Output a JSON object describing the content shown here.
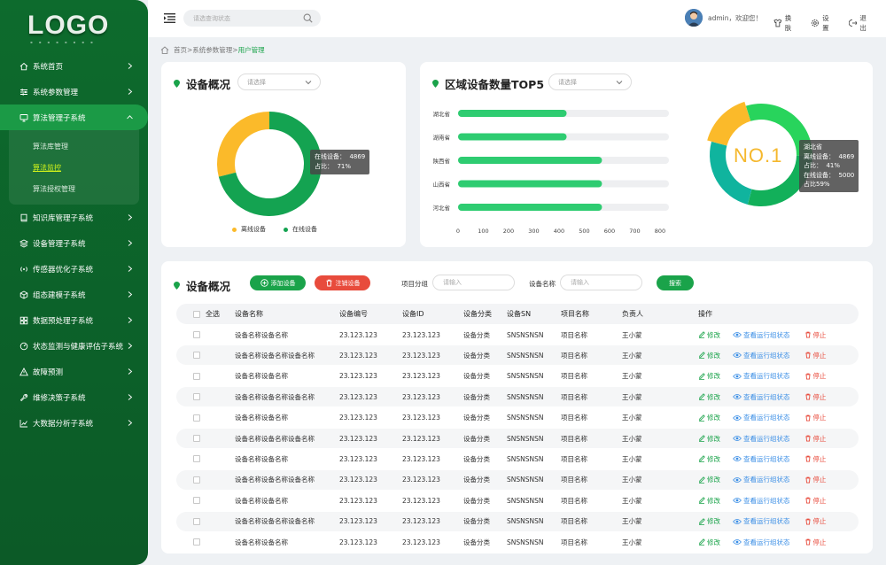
{
  "brand": {
    "logo": "LOGO"
  },
  "colors": {
    "primary": "#0d6b2d",
    "accent": "#1aa34a",
    "online": "#14a351",
    "offline": "#fbba2a",
    "danger": "#e84b3c",
    "link": "#3a8ee6"
  },
  "sidebar": {
    "items": [
      {
        "label": "系统首页",
        "icon": "home-icon"
      },
      {
        "label": "系统参数管理",
        "icon": "sliders-icon"
      },
      {
        "label": "算法管理子系统",
        "icon": "monitor-icon",
        "expanded": true,
        "children": [
          {
            "label": "算法库管理"
          },
          {
            "label": "算法监控",
            "active": true
          },
          {
            "label": "算法授权管理"
          }
        ]
      },
      {
        "label": "知识库管理子系统",
        "icon": "book-icon"
      },
      {
        "label": "设备管理子系统",
        "icon": "layers-icon"
      },
      {
        "label": "传感器优化子系统",
        "icon": "signal-icon"
      },
      {
        "label": "组态建模子系统",
        "icon": "cube-icon"
      },
      {
        "label": "数据预处理子系统",
        "icon": "grid-icon"
      },
      {
        "label": "状态监测与健康评估子系统",
        "icon": "gauge-icon"
      },
      {
        "label": "故障预测",
        "icon": "alert-icon"
      },
      {
        "label": "维修决策子系统",
        "icon": "wrench-icon"
      },
      {
        "label": "大数据分析子系统",
        "icon": "chart-icon"
      }
    ]
  },
  "header": {
    "search_placeholder": "请选查询状态",
    "user_text": "admin，欢迎您！",
    "tools": [
      {
        "label": "换肤",
        "icon": "skin-icon"
      },
      {
        "label": "设置",
        "icon": "gear-icon"
      },
      {
        "label": "退出",
        "icon": "logout-icon"
      }
    ]
  },
  "breadcrumb": {
    "home": "首页",
    "sep1": ">",
    "level1": "系统参数管理",
    "sep2": ">",
    "current": "用户管理"
  },
  "overview_card": {
    "title": "设备概况",
    "select_placeholder": "请选择",
    "tooltip_line1": "在线设备：  4869",
    "tooltip_line2": "占比：  71%",
    "legend": [
      "离线设备",
      "在线设备"
    ]
  },
  "top5_card": {
    "title": "区域设备数量TOP5",
    "select_placeholder": "请选择",
    "badge": "NO.1",
    "tooltip_title": "湖北省",
    "tooltip_line1": "离线设备：  4869",
    "tooltip_line2": "占比：  41%",
    "tooltip_line3": "在线设备：  5000",
    "tooltip_line4": "占比59%"
  },
  "chart_data": [
    {
      "type": "pie",
      "variant": "donut",
      "categories": [
        "离线设备",
        "在线设备"
      ],
      "values": [
        29,
        71
      ],
      "colors": [
        "#fbba2a",
        "#14a351"
      ],
      "legend": "bottom"
    },
    {
      "type": "bar",
      "orientation": "horizontal",
      "categories": [
        "湖北省",
        "湖南省",
        "陕西省",
        "山西省",
        "河北省"
      ],
      "values": [
        430,
        430,
        570,
        570,
        570
      ],
      "xlim": [
        0,
        800
      ],
      "xticks": [
        "0",
        "100",
        "200",
        "300",
        "400",
        "500",
        "600",
        "700",
        "800"
      ],
      "bar_color": "#2ecc71"
    },
    {
      "type": "pie",
      "variant": "donut",
      "categories": [
        "在线设备",
        "离线设备"
      ],
      "values": [
        59,
        41
      ],
      "segments": [
        {
          "color": "#28d45c",
          "value": 30
        },
        {
          "color": "#12b05a",
          "value": 29
        },
        {
          "color": "#10b49e",
          "value": 25
        },
        {
          "color": "#fbba2a",
          "value": 16
        }
      ]
    }
  ],
  "table_card": {
    "title": "设备概况",
    "add_button": "添加设备",
    "delete_button": "注销设备",
    "group_label": "项目分组",
    "group_placeholder": "请输入",
    "name_label": "设备名称",
    "name_placeholder": "请输入",
    "search_button": "搜索",
    "columns": [
      "全选",
      "设备名称",
      "设备编号",
      "设备ID",
      "设备分类",
      "设备SN",
      "项目名称",
      "负责人",
      "操作"
    ],
    "actions": {
      "edit": "修改",
      "view": "查看运行组状态",
      "stop": "停止"
    },
    "rows": [
      [
        "设备名称设备名称",
        "23.123.123",
        "23.123.123",
        "设备分类",
        "SNSNSNSN",
        "项目名称",
        "王小蒙"
      ],
      [
        "设备名称设备名称设备名称",
        "23.123.123",
        "23.123.123",
        "设备分类",
        "SNSNSNSN",
        "项目名称",
        "王小蒙"
      ],
      [
        "设备名称设备名称",
        "23.123.123",
        "23.123.123",
        "设备分类",
        "SNSNSNSN",
        "项目名称",
        "王小蒙"
      ],
      [
        "设备名称设备名称设备名称",
        "23.123.123",
        "23.123.123",
        "设备分类",
        "SNSNSNSN",
        "项目名称",
        "王小蒙"
      ],
      [
        "设备名称设备名称",
        "23.123.123",
        "23.123.123",
        "设备分类",
        "SNSNSNSN",
        "项目名称",
        "王小蒙"
      ],
      [
        "设备名称设备名称设备名称",
        "23.123.123",
        "23.123.123",
        "设备分类",
        "SNSNSNSN",
        "项目名称",
        "王小蒙"
      ],
      [
        "设备名称设备名称",
        "23.123.123",
        "23.123.123",
        "设备分类",
        "SNSNSNSN",
        "项目名称",
        "王小蒙"
      ],
      [
        "设备名称设备名称设备名称",
        "23.123.123",
        "23.123.123",
        "设备分类",
        "SNSNSNSN",
        "项目名称",
        "王小蒙"
      ],
      [
        "设备名称设备名称",
        "23.123.123",
        "23.123.123",
        "设备分类",
        "SNSNSNSN",
        "项目名称",
        "王小蒙"
      ],
      [
        "设备名称设备名称设备名称",
        "23.123.123",
        "23.123.123",
        "设备分类",
        "SNSNSNSN",
        "项目名称",
        "王小蒙"
      ],
      [
        "设备名称设备名称",
        "23.123.123",
        "23.123.123",
        "设备分类",
        "SNSNSNSN",
        "项目名称",
        "王小蒙"
      ]
    ]
  }
}
